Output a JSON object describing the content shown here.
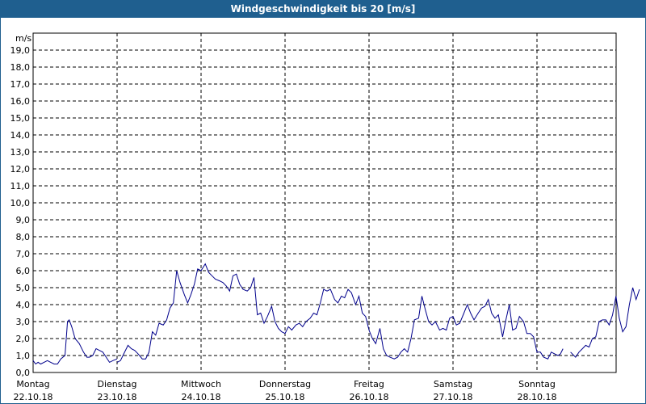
{
  "window": {
    "title": "Windgeschwindigkeit bis 20 [m/s]"
  },
  "colors": {
    "titlebar": "#1f5f8f",
    "series": "#00008b",
    "grid": "#000000"
  },
  "chart_data": {
    "type": "line",
    "title": "Windgeschwindigkeit bis 20 [m/s]",
    "ylabel": "m/s",
    "xlabel": "",
    "ylim": [
      0,
      20
    ],
    "yticks": [
      0,
      1,
      2,
      3,
      4,
      5,
      6,
      7,
      8,
      9,
      10,
      11,
      12,
      13,
      14,
      15,
      16,
      17,
      18,
      19
    ],
    "ytick_labels": [
      "0,0",
      "1,0",
      "2,0",
      "3,0",
      "4,0",
      "5,0",
      "6,0",
      "7,0",
      "8,0",
      "9,0",
      "10,0",
      "11,0",
      "12,0",
      "13,0",
      "14,0",
      "15,0",
      "16,0",
      "17,0",
      "18,0",
      "19,0"
    ],
    "xlim": [
      0,
      7
    ],
    "grid": true,
    "day_labels": [
      {
        "day": "Montag",
        "date": "22.10.18"
      },
      {
        "day": "Dienstag",
        "date": "23.10.18"
      },
      {
        "day": "Mittwoch",
        "date": "24.10.18"
      },
      {
        "day": "Donnerstag",
        "date": "25.10.18"
      },
      {
        "day": "Freitag",
        "date": "26.10.18"
      },
      {
        "day": "Samstag",
        "date": "27.10.18"
      },
      {
        "day": "Sonntag",
        "date": "28.10.18"
      }
    ],
    "series": [
      {
        "segments": [
          [
            [
              0.0,
              0.7
            ],
            [
              0.03,
              0.5
            ],
            [
              0.06,
              0.6
            ],
            [
              0.09,
              0.5
            ],
            [
              0.13,
              0.6
            ],
            [
              0.17,
              0.7
            ],
            [
              0.21,
              0.6
            ],
            [
              0.25,
              0.5
            ],
            [
              0.29,
              0.5
            ],
            [
              0.33,
              0.8
            ],
            [
              0.38,
              1.0
            ],
            [
              0.41,
              3.0
            ],
            [
              0.43,
              3.1
            ],
            [
              0.46,
              2.7
            ],
            [
              0.5,
              2.0
            ],
            [
              0.55,
              1.7
            ],
            [
              0.6,
              1.2
            ],
            [
              0.64,
              0.9
            ],
            [
              0.67,
              0.9
            ],
            [
              0.71,
              1.0
            ],
            [
              0.75,
              1.4
            ],
            [
              0.79,
              1.3
            ],
            [
              0.83,
              1.2
            ],
            [
              0.87,
              0.9
            ],
            [
              0.91,
              0.6
            ],
            [
              0.95,
              0.7
            ],
            [
              1.0,
              0.8
            ]
          ],
          [
            [
              1.0,
              0.6
            ],
            [
              1.04,
              0.7
            ],
            [
              1.08,
              1.1
            ],
            [
              1.13,
              1.6
            ],
            [
              1.17,
              1.4
            ],
            [
              1.21,
              1.3
            ],
            [
              1.25,
              1.1
            ],
            [
              1.3,
              0.8
            ],
            [
              1.34,
              0.8
            ],
            [
              1.38,
              1.2
            ],
            [
              1.42,
              2.4
            ],
            [
              1.46,
              2.2
            ],
            [
              1.5,
              2.9
            ],
            [
              1.55,
              2.8
            ],
            [
              1.59,
              3.1
            ],
            [
              1.63,
              3.8
            ],
            [
              1.67,
              4.1
            ],
            [
              1.71,
              6.0
            ],
            [
              1.75,
              5.3
            ],
            [
              1.8,
              4.6
            ],
            [
              1.84,
              4.1
            ],
            [
              1.88,
              4.6
            ],
            [
              1.92,
              5.2
            ],
            [
              1.96,
              6.1
            ],
            [
              2.0,
              6.0
            ],
            [
              2.05,
              6.4
            ],
            [
              2.09,
              5.9
            ],
            [
              2.13,
              5.7
            ],
            [
              2.17,
              5.5
            ],
            [
              2.22,
              5.4
            ],
            [
              2.26,
              5.3
            ],
            [
              2.3,
              5.1
            ],
            [
              2.34,
              4.8
            ],
            [
              2.38,
              5.7
            ],
            [
              2.42,
              5.8
            ],
            [
              2.46,
              5.2
            ],
            [
              2.5,
              4.9
            ],
            [
              2.55,
              4.8
            ],
            [
              2.59,
              5.0
            ],
            [
              2.63,
              5.6
            ],
            [
              2.67,
              3.4
            ],
            [
              2.71,
              3.5
            ],
            [
              2.75,
              2.9
            ],
            [
              2.79,
              3.3
            ],
            [
              2.84,
              3.9
            ],
            [
              2.88,
              3.0
            ],
            [
              2.92,
              2.6
            ],
            [
              2.96,
              2.4
            ],
            [
              3.0,
              2.3
            ],
            [
              3.04,
              2.7
            ],
            [
              3.08,
              2.5
            ],
            [
              3.13,
              2.8
            ],
            [
              3.17,
              2.9
            ],
            [
              3.21,
              2.7
            ],
            [
              3.25,
              3.0
            ],
            [
              3.3,
              3.2
            ],
            [
              3.34,
              3.5
            ],
            [
              3.38,
              3.4
            ],
            [
              3.42,
              4.1
            ],
            [
              3.46,
              4.9
            ],
            [
              3.5,
              4.8
            ],
            [
              3.54,
              4.9
            ],
            [
              3.59,
              4.3
            ],
            [
              3.63,
              4.1
            ],
            [
              3.67,
              4.5
            ],
            [
              3.71,
              4.4
            ],
            [
              3.75,
              4.9
            ],
            [
              3.79,
              4.7
            ],
            [
              3.84,
              4.0
            ],
            [
              3.88,
              4.5
            ],
            [
              3.92,
              3.5
            ],
            [
              3.96,
              3.3
            ],
            [
              4.0,
              2.5
            ],
            [
              4.04,
              2.0
            ],
            [
              4.08,
              1.7
            ],
            [
              4.13,
              2.6
            ],
            [
              4.17,
              1.4
            ],
            [
              4.21,
              1.0
            ],
            [
              4.25,
              0.9
            ],
            [
              4.3,
              0.8
            ],
            [
              4.34,
              0.9
            ],
            [
              4.38,
              1.2
            ],
            [
              4.42,
              1.4
            ],
            [
              4.46,
              1.2
            ],
            [
              4.5,
              2.0
            ],
            [
              4.54,
              3.1
            ],
            [
              4.59,
              3.2
            ],
            [
              4.63,
              4.5
            ],
            [
              4.67,
              3.7
            ],
            [
              4.71,
              3.0
            ],
            [
              4.75,
              2.8
            ],
            [
              4.79,
              3.0
            ],
            [
              4.84,
              2.5
            ],
            [
              4.88,
              2.6
            ],
            [
              4.92,
              2.5
            ],
            [
              4.96,
              3.2
            ],
            [
              5.0,
              3.3
            ],
            [
              5.04,
              2.8
            ],
            [
              5.08,
              2.9
            ],
            [
              5.13,
              3.5
            ],
            [
              5.17,
              4.0
            ],
            [
              5.21,
              3.5
            ],
            [
              5.25,
              3.1
            ],
            [
              5.3,
              3.5
            ],
            [
              5.34,
              3.8
            ],
            [
              5.38,
              3.9
            ],
            [
              5.42,
              4.3
            ],
            [
              5.46,
              3.5
            ],
            [
              5.5,
              3.2
            ],
            [
              5.54,
              3.4
            ],
            [
              5.59,
              2.1
            ],
            [
              5.63,
              3.1
            ],
            [
              5.67,
              4.0
            ],
            [
              5.71,
              2.5
            ],
            [
              5.75,
              2.6
            ],
            [
              5.79,
              3.3
            ],
            [
              5.84,
              3.0
            ],
            [
              5.88,
              2.3
            ],
            [
              5.92,
              2.3
            ],
            [
              5.96,
              2.1
            ],
            [
              6.0,
              1.2
            ],
            [
              6.04,
              1.2
            ],
            [
              6.08,
              0.9
            ],
            [
              6.13,
              0.8
            ],
            [
              6.17,
              1.2
            ],
            [
              6.21,
              1.1
            ],
            [
              6.25,
              1.0
            ],
            [
              6.28,
              1.1
            ],
            [
              6.31,
              1.4
            ]
          ],
          [
            [
              6.4,
              1.2
            ],
            [
              6.46,
              0.9
            ],
            [
              6.5,
              1.2
            ],
            [
              6.54,
              1.4
            ],
            [
              6.58,
              1.6
            ],
            [
              6.62,
              1.5
            ],
            [
              6.66,
              2.0
            ],
            [
              6.7,
              2.1
            ],
            [
              6.74,
              3.0
            ],
            [
              6.78,
              3.1
            ],
            [
              6.82,
              3.1
            ],
            [
              6.86,
              2.8
            ],
            [
              6.9,
              3.4
            ],
            [
              6.94,
              4.5
            ],
            [
              6.98,
              3.2
            ],
            [
              7.02,
              2.4
            ],
            [
              7.06,
              2.7
            ],
            [
              7.1,
              4.0
            ],
            [
              7.14,
              5.0
            ],
            [
              7.18,
              4.3
            ],
            [
              7.22,
              4.9
            ]
          ]
        ]
      }
    ]
  }
}
